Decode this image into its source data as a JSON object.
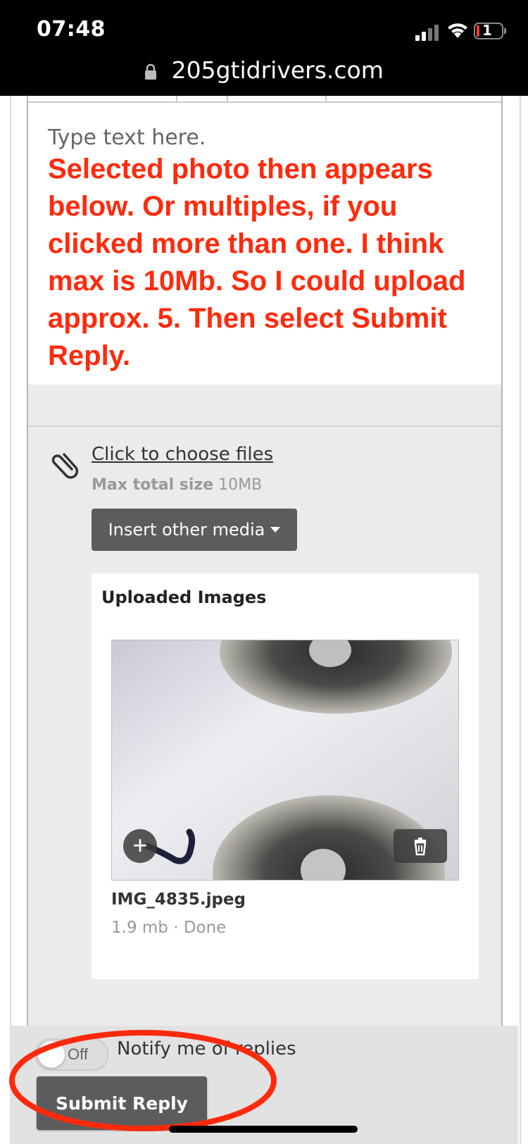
{
  "status_bar": {
    "time": "07:48",
    "battery_level": "1",
    "url": "205gtidrivers.com"
  },
  "editor": {
    "placeholder": "Type text here.",
    "annotation": "Selected photo then appears below. Or multiples, if you clicked more than one. I think max is 10Mb. So I could upload approx. 5. Then select Submit Reply.",
    "annotation_color": "#ff2a0c"
  },
  "attachments": {
    "choose_files_label": "Click to choose files",
    "max_size_label": "Max total size",
    "max_size_value": "10MB",
    "insert_media_label": "Insert other media",
    "uploaded_title": "Uploaded Images",
    "file": {
      "name": "IMG_4835.jpeg",
      "meta": "1.9 mb · Done"
    }
  },
  "reply": {
    "toggle_text": "Off",
    "notify_label": "Notify me of replies",
    "submit_label": "Submit Reply"
  },
  "icons": {
    "lock": "lock-icon",
    "clip": "paperclip-icon",
    "plus": "plus-icon",
    "trash": "trash-icon"
  },
  "colors": {
    "button_bg": "#5c5c5c",
    "highlight_ellipse": "#ff2a0c"
  }
}
